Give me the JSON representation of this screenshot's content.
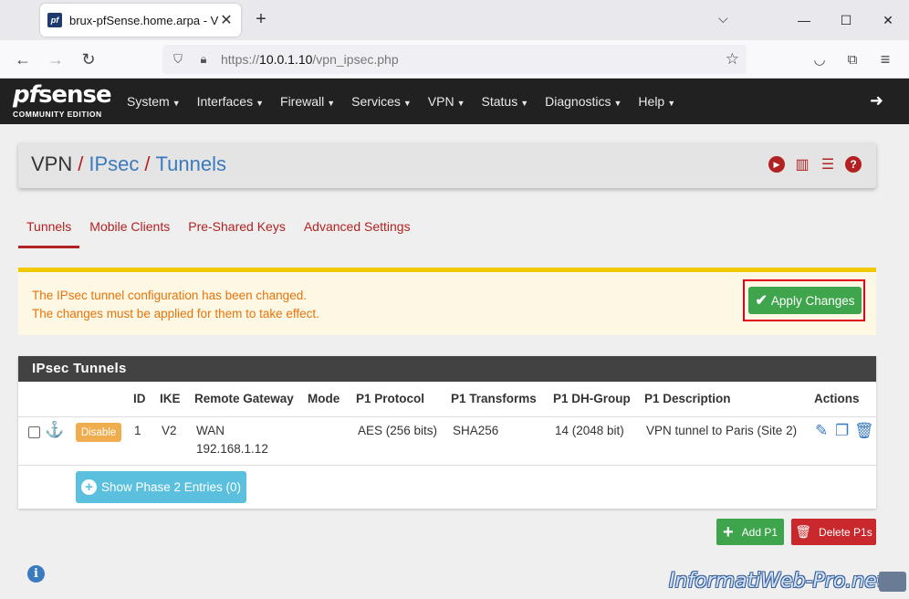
{
  "browser": {
    "tab_title": "brux-pfSense.home.arpa - VPN",
    "favicon_text": "pf",
    "url_prefix": "https://",
    "url_host": "10.0.1.10",
    "url_path": "/vpn_ipsec.php"
  },
  "header": {
    "logo_main": "sense",
    "logo_pf": "pf",
    "logo_sub": "COMMUNITY EDITION",
    "menu": [
      {
        "label": "System"
      },
      {
        "label": "Interfaces"
      },
      {
        "label": "Firewall"
      },
      {
        "label": "Services"
      },
      {
        "label": "VPN"
      },
      {
        "label": "Status"
      },
      {
        "label": "Diagnostics"
      },
      {
        "label": "Help"
      }
    ]
  },
  "breadcrumb": {
    "root": "VPN",
    "level1": "IPsec",
    "level2": "Tunnels",
    "sep": "/"
  },
  "tabs": [
    "Tunnels",
    "Mobile Clients",
    "Pre-Shared Keys",
    "Advanced Settings"
  ],
  "alert": {
    "line1": "The IPsec tunnel configuration has been changed.",
    "line2": "The changes must be applied for them to take effect.",
    "apply_label": "Apply Changes"
  },
  "table": {
    "title": "IPsec Tunnels",
    "columns": [
      "ID",
      "IKE",
      "Remote Gateway",
      "Mode",
      "P1 Protocol",
      "P1 Transforms",
      "P1 DH-Group",
      "P1 Description",
      "Actions"
    ],
    "row": {
      "disable_label": "Disable",
      "id": "1",
      "ike": "V2",
      "gateway_iface": "WAN",
      "gateway_ip": "192.168.1.12",
      "mode": "",
      "protocol": "AES (256 bits)",
      "transforms": "SHA256",
      "dh_group": "14 (2048 bit)",
      "description": "VPN tunnel to Paris (Site 2)"
    },
    "phase2_label": "Show Phase 2 Entries (0)"
  },
  "buttons": {
    "add_p1": "Add P1",
    "delete_p1s": "Delete P1s"
  },
  "watermark": "InformatiWeb-Pro.net"
}
